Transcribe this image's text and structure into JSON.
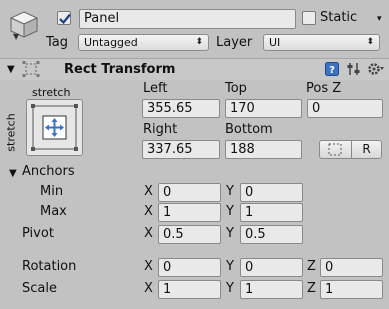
{
  "object": {
    "name": "Panel",
    "active": true,
    "static_label": "Static",
    "static_checked": false,
    "static_arrow": "▾",
    "tag_label": "Tag",
    "tag_value": "Untagged",
    "layer_label": "Layer",
    "layer_value": "UI",
    "dropdown_arrow": "⬍"
  },
  "component": {
    "title": "Rect Transform",
    "foldout": "▼",
    "anchor_preset": {
      "top_label": "stretch",
      "side_label": "stretch"
    },
    "columns": {
      "left_label": "Left",
      "top_label": "Top",
      "posz_label": "Pos Z",
      "right_label": "Right",
      "bottom_label": "Bottom"
    },
    "values": {
      "left": "355.65",
      "top": "170",
      "posz": "0",
      "right": "337.65",
      "bottom": "188"
    },
    "r_button_label": "R"
  },
  "anchors": {
    "label": "Anchors",
    "foldout": "▼",
    "min_label": "Min",
    "max_label": "Max",
    "min": {
      "x": "0",
      "y": "0"
    },
    "max": {
      "x": "1",
      "y": "1"
    }
  },
  "pivot": {
    "label": "Pivot",
    "x": "0.5",
    "y": "0.5"
  },
  "rotation": {
    "label": "Rotation",
    "x": "0",
    "y": "0",
    "z": "0"
  },
  "scale": {
    "label": "Scale",
    "x": "1",
    "y": "1",
    "z": "1"
  },
  "axes": {
    "x": "X",
    "y": "Y",
    "z": "Z"
  },
  "colors": {
    "background": "#c2c2c2",
    "field": "#e9e9e9",
    "accent_blue": "#3b73c4"
  }
}
